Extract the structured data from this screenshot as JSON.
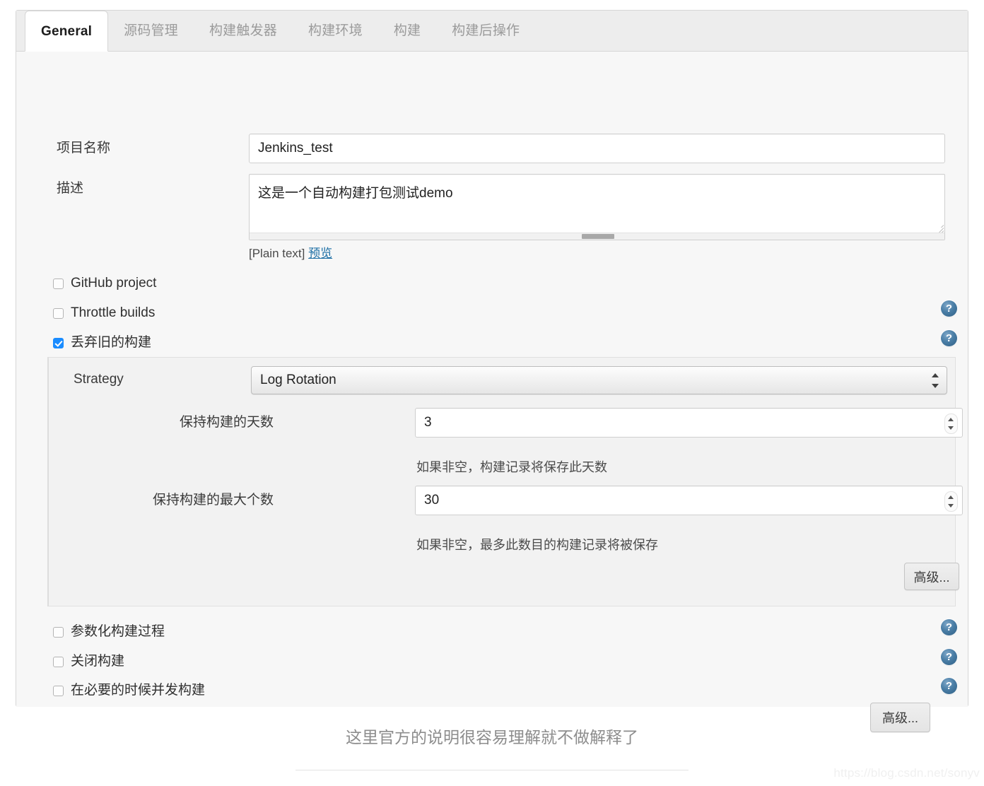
{
  "tabs": [
    {
      "label": "General",
      "active": true
    },
    {
      "label": "源码管理",
      "active": false
    },
    {
      "label": "构建触发器",
      "active": false
    },
    {
      "label": "构建环境",
      "active": false
    },
    {
      "label": "构建",
      "active": false
    },
    {
      "label": "构建后操作",
      "active": false
    }
  ],
  "form": {
    "project_name_label": "项目名称",
    "project_name_value": "Jenkins_test",
    "description_label": "描述",
    "description_value": "这是一个自动构建打包测试demo",
    "markup_type": "[Plain text]",
    "preview_link": "预览"
  },
  "checkboxes": {
    "github_project": {
      "label": "GitHub project",
      "checked": false
    },
    "throttle_builds": {
      "label": "Throttle builds",
      "checked": false
    },
    "discard_old_builds": {
      "label": "丢弃旧的构建",
      "checked": true
    },
    "parameterized_build": {
      "label": "参数化构建过程",
      "checked": false
    },
    "disable_build": {
      "label": "关闭构建",
      "checked": false
    },
    "concurrent_build": {
      "label": "在必要的时候并发构建",
      "checked": false
    }
  },
  "strategy": {
    "label": "Strategy",
    "selected": "Log Rotation",
    "options": [
      "Log Rotation"
    ],
    "days_label": "保持构建的天数",
    "days_value": "3",
    "days_help": "如果非空，构建记录将保存此天数",
    "max_label": "保持构建的最大个数",
    "max_value": "30",
    "max_help": "如果非空，最多此数目的构建记录将被保存",
    "advanced_button": "高级..."
  },
  "bottom": {
    "advanced_button": "高级..."
  },
  "icons": {
    "help": "help-question-icon"
  },
  "caption": "这里官方的说明很容易理解就不做解释了",
  "watermark": "https://blog.csdn.net/sonyv",
  "colors": {
    "accent": "#1a8cff",
    "link": "#1d6fa5",
    "panel_bg": "#f7f7f7",
    "nested_panel_bg": "#f2f2f2"
  }
}
